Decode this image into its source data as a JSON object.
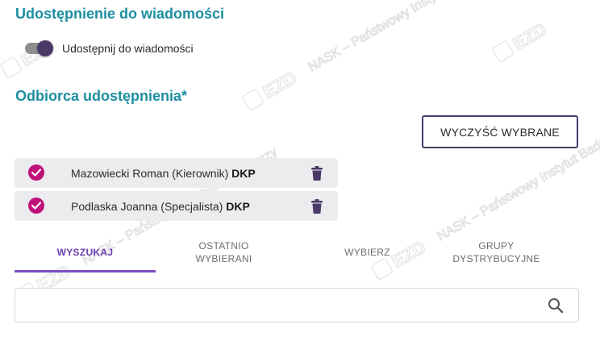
{
  "sections": {
    "sharing_title": "Udostępnienie do wiadomości",
    "recipient_title": "Odbiorca udostępnienia*"
  },
  "toggle": {
    "label": "Udostępnij do wiadomości",
    "state": "on"
  },
  "clear_button": {
    "label": "WYCZYŚĆ WYBRANE"
  },
  "recipients": [
    {
      "name": "Mazowiecki Roman (Kierownik)",
      "unit": "DKP"
    },
    {
      "name": "Podlaska Joanna (Specjalista)",
      "unit": "DKP"
    }
  ],
  "tabs": [
    {
      "label": "WYSZUKAJ",
      "active": true
    },
    {
      "label": "OSTATNIO WYBIERANI",
      "active": false
    },
    {
      "label": "WYBIERZ",
      "active": false
    },
    {
      "label": "GRUPY DYSTRYBUCYJNE",
      "active": false
    }
  ],
  "search": {
    "value": "",
    "placeholder": ""
  },
  "watermark": {
    "text": "EZD RP · NASK – Państwowy Instytut Badawczy"
  },
  "colors": {
    "title": "#1d8fa0",
    "accent": "#4b3a68",
    "check": "#c0117a",
    "tab_active": "#6b3fb0",
    "recipient_bg": "#ececef"
  }
}
